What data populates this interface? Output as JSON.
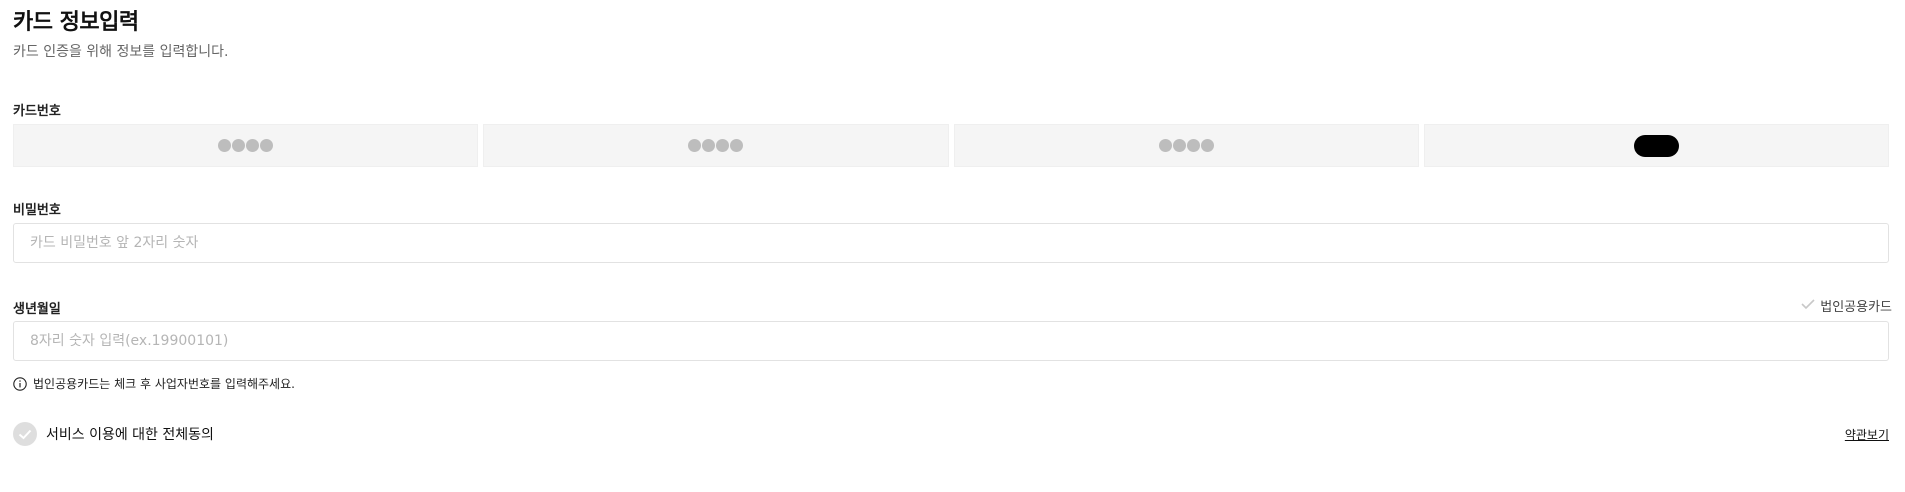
{
  "header": {
    "title": "카드 정보입력",
    "subtitle": "카드 인증을 위해 정보를 입력합니다."
  },
  "card_number": {
    "label": "카드번호",
    "fields": [
      {
        "masked": "●●●●"
      },
      {
        "masked": "●●●●"
      },
      {
        "masked": "●●●●"
      },
      {
        "masked": "redacted"
      }
    ]
  },
  "password": {
    "label": "비밀번호",
    "placeholder": "카드 비밀번호 앞 2자리 숫자",
    "value": ""
  },
  "birthdate": {
    "label": "생년월일",
    "placeholder": "8자리 숫자 입력(ex.19900101)",
    "value": "",
    "corporate_toggle_label": "법인공용카드"
  },
  "notice": {
    "text": "법인공용카드는 체크 후 사업자번호를 입력해주세요."
  },
  "agreement": {
    "label": "서비스 이용에 대한 전체동의",
    "terms_link": "약관보기"
  },
  "colors": {
    "dot": "#bdbdbd",
    "field_bg": "#f5f5f5",
    "check_bg": "#dedede"
  }
}
